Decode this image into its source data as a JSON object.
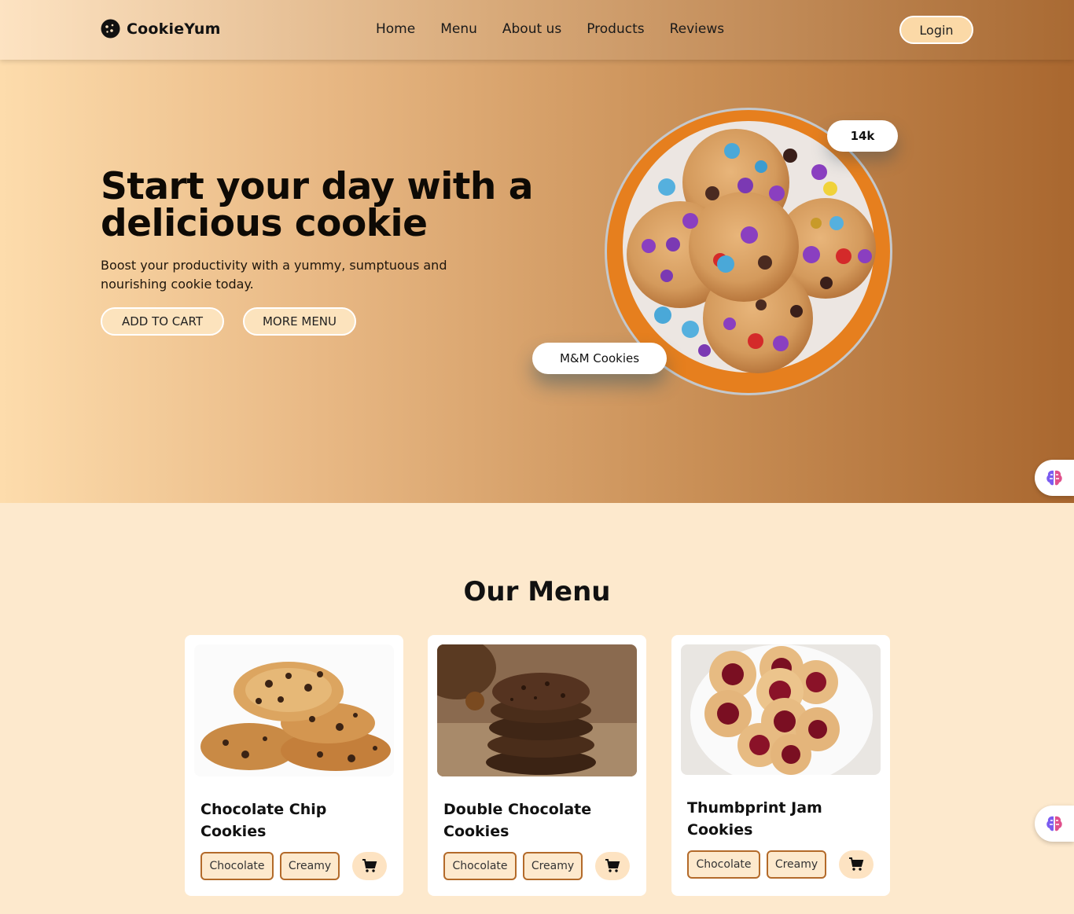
{
  "nav": {
    "brand": "CookieYum",
    "links": [
      "Home",
      "Menu",
      "About us",
      "Products",
      "Reviews"
    ],
    "login_label": "Login"
  },
  "hero": {
    "title": "Start your day with a delicious cookie",
    "subtitle": "Boost your productivity with a yummy, sumptuous and nourishing cookie today.",
    "add_to_cart_label": "ADD TO CART",
    "more_menu_label": "MORE MENU",
    "likes_badge": "14k",
    "featured_label": "M&M Cookies"
  },
  "menu": {
    "title": "Our Menu",
    "items": [
      {
        "name": "Chocolate Chip Cookies",
        "tags": [
          "Chocolate",
          "Creamy"
        ],
        "icon": "shopping-cart-icon"
      },
      {
        "name": "Double Chocolate Cookies",
        "tags": [
          "Chocolate",
          "Creamy"
        ],
        "icon": "shopping-cart-icon"
      },
      {
        "name": "Thumbprint Jam Cookies",
        "tags": [
          "Chocolate",
          "Creamy"
        ],
        "icon": "shopping-cart-icon"
      }
    ]
  },
  "colors": {
    "accent": "#b36a2a",
    "background": "#fde9cd",
    "button": "#fbd9a7"
  },
  "icons": [
    "cookie-logo-icon",
    "brain-assistant-icon",
    "shopping-cart-icon"
  ]
}
